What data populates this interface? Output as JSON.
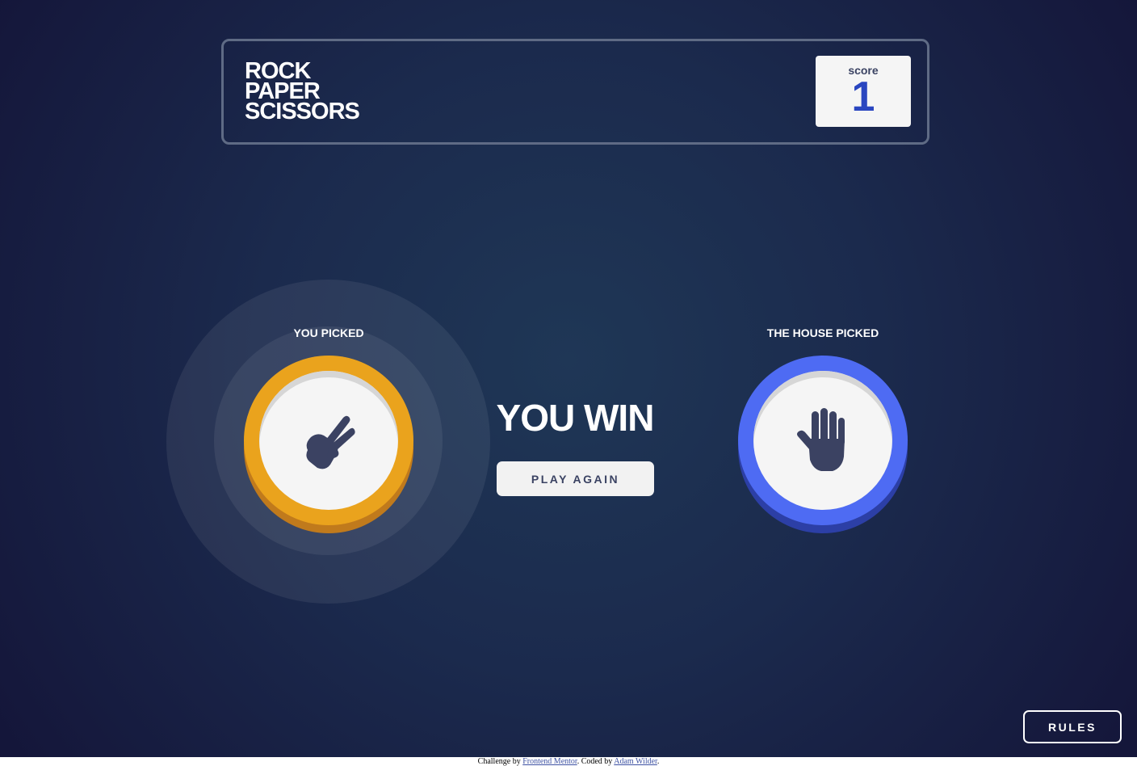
{
  "header": {
    "title_lines": [
      "ROCK",
      "PAPER",
      "SCISSORS"
    ],
    "score_label": "score",
    "score_value": "1"
  },
  "player": {
    "label": "YOU PICKED",
    "choice": "scissors",
    "icon": "scissors-hand-icon",
    "ring_color": "#eaa31d"
  },
  "house": {
    "label": "THE HOUSE PICKED",
    "choice": "paper",
    "icon": "paper-hand-icon",
    "ring_color": "#4e6bf3"
  },
  "result": {
    "text": "YOU WIN",
    "button_label": "PLAY AGAIN"
  },
  "rules_button": {
    "label": "RULES"
  },
  "attribution": {
    "prefix": "Challenge by ",
    "link1": "Frontend Mentor",
    "middle": ". Coded by ",
    "link2": "Adam Wilder",
    "suffix": "."
  }
}
